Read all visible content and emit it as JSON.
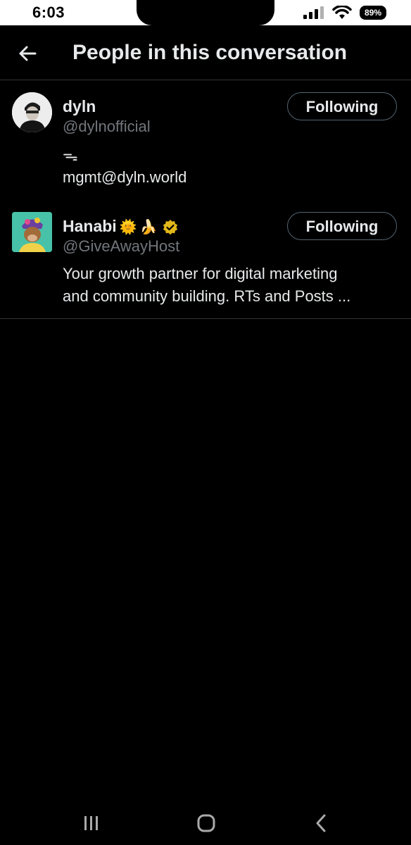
{
  "status_bar": {
    "time": "6:03",
    "battery_percent": "89%",
    "signal_icon": "signal-bars-icon",
    "wifi_icon": "wifi-icon"
  },
  "header": {
    "back_icon": "arrow-left-icon",
    "title": "People in this conversation"
  },
  "users": [
    {
      "name": "dyln",
      "handle": "@dylnofficial",
      "bio_lines": [
        "ᯓ",
        "mgmt@dyln.world"
      ],
      "follow_label": "Following",
      "avatar_icon": "avatar-photo"
    },
    {
      "name": "Hanabi",
      "name_emojis": [
        "🌞",
        "🍌"
      ],
      "verified": true,
      "handle": "@GiveAwayHost",
      "bio_lines": [
        "Your growth partner for digital marketing",
        "and community building. RTs and Posts ..."
      ],
      "follow_label": "Following",
      "avatar_icon": "nft-ape-avatar"
    }
  ],
  "nav_bar": {
    "recents_icon": "recents-icon",
    "home_icon": "home-icon",
    "back_icon": "back-chevron-icon"
  },
  "colors": {
    "background": "#000000",
    "text_primary": "#e7e9ea",
    "text_secondary": "#71767b",
    "divider": "#2f3336",
    "verified_badge": "#e2b719"
  }
}
